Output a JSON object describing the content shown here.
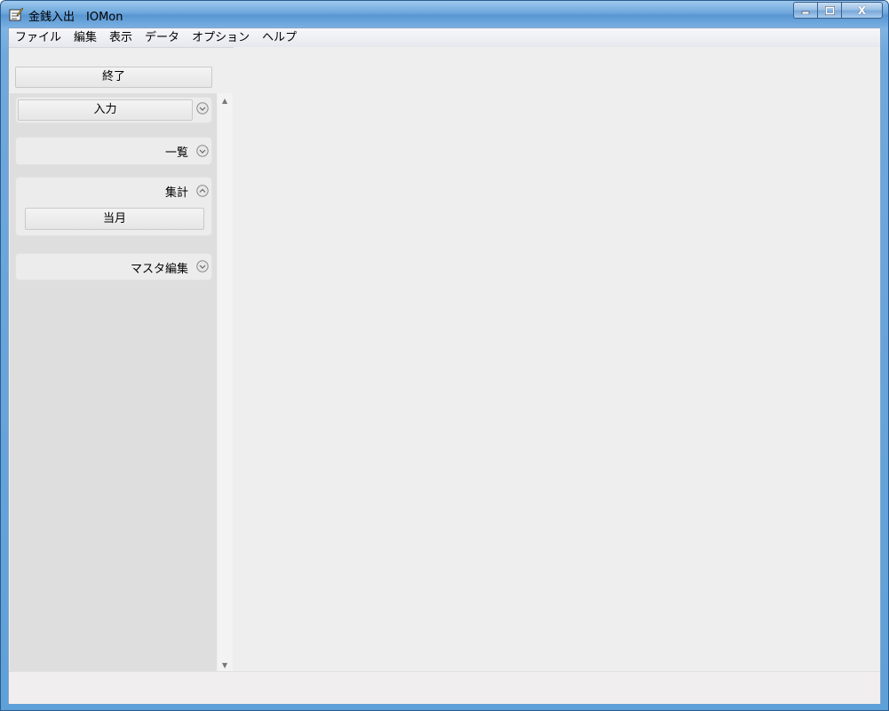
{
  "window": {
    "title": "金銭入出　IOMon",
    "minimize_glyph": "▬",
    "maximize_glyph": "□",
    "close_glyph": "X",
    "app_icon": "notepad-pencil-icon"
  },
  "menu": {
    "items": [
      "ファイル",
      "編集",
      "表示",
      "データ",
      "オプション",
      "ヘルプ"
    ]
  },
  "toolbar": {
    "exit_label": "終了"
  },
  "sidebar": {
    "groups": [
      {
        "title": "",
        "button": "入力",
        "state": "collapsed"
      },
      {
        "title": "一覧",
        "state": "collapsed"
      },
      {
        "title": "集計",
        "button": "当月",
        "state": "expanded"
      },
      {
        "title": "マスタ編集",
        "state": "collapsed"
      }
    ],
    "scroll_up": "▲",
    "scroll_down": "▼"
  }
}
